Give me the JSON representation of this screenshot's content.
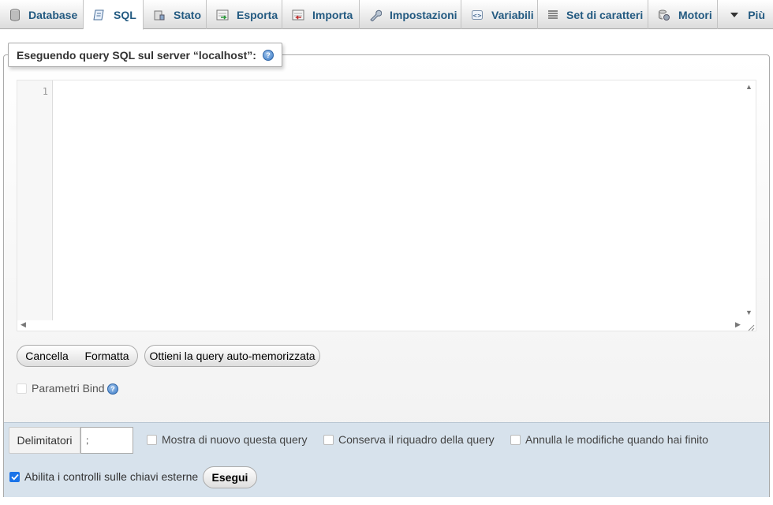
{
  "tabs": [
    {
      "label": "Database",
      "icon": "database-icon"
    },
    {
      "label": "SQL",
      "icon": "sql-icon",
      "active": true
    },
    {
      "label": "Stato",
      "icon": "status-icon"
    },
    {
      "label": "Esporta",
      "icon": "export-icon"
    },
    {
      "label": "Importa",
      "icon": "import-icon"
    },
    {
      "label": "Impostazioni",
      "icon": "wrench-icon"
    },
    {
      "label": "Variabili",
      "icon": "variables-icon"
    },
    {
      "label": "Set di caratteri",
      "icon": "charset-icon"
    },
    {
      "label": "Motori",
      "icon": "engine-icon"
    },
    {
      "label": "Più",
      "icon": "caret-down-icon"
    }
  ],
  "query_box": {
    "legend": "Eseguendo query SQL sul server “localhost”:",
    "line_number": "1",
    "editor_value": ""
  },
  "buttons": {
    "clear": "Cancella",
    "format": "Formatta",
    "autosaved": "Ottieni la query auto-memorizzata",
    "go": "Esegui"
  },
  "bind_params": {
    "label": "Parametri Bind",
    "checked": false
  },
  "options": {
    "delimiter_label": "Delimitatori",
    "delimiter_value": ";",
    "show_query": {
      "label": "Mostra di nuovo questa query",
      "checked": false
    },
    "retain_box": {
      "label": "Conserva il riquadro della query",
      "checked": false
    },
    "rollback": {
      "label": "Annulla le modifiche quando hai finito",
      "checked": false
    },
    "fk_checks": {
      "label": "Abilita i controlli sulle chiavi esterne",
      "checked": true
    }
  },
  "colors": {
    "tab_text": "#235a81",
    "options_bg": "#d7e2ec",
    "checkbox_checked": "#1a73e8"
  }
}
